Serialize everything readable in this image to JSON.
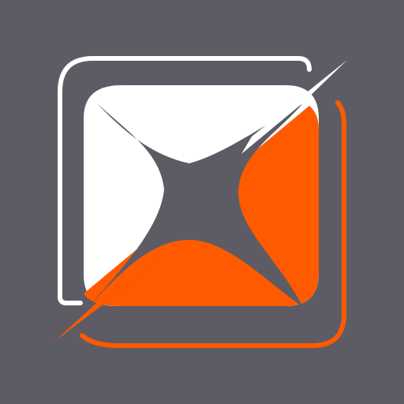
{
  "app_icon": {
    "icon": "x-logo-icon",
    "colors": {
      "background": "#5d5c65",
      "white": "#ffffff",
      "accent": "#ff5a00",
      "center": "#5d5c65"
    }
  }
}
